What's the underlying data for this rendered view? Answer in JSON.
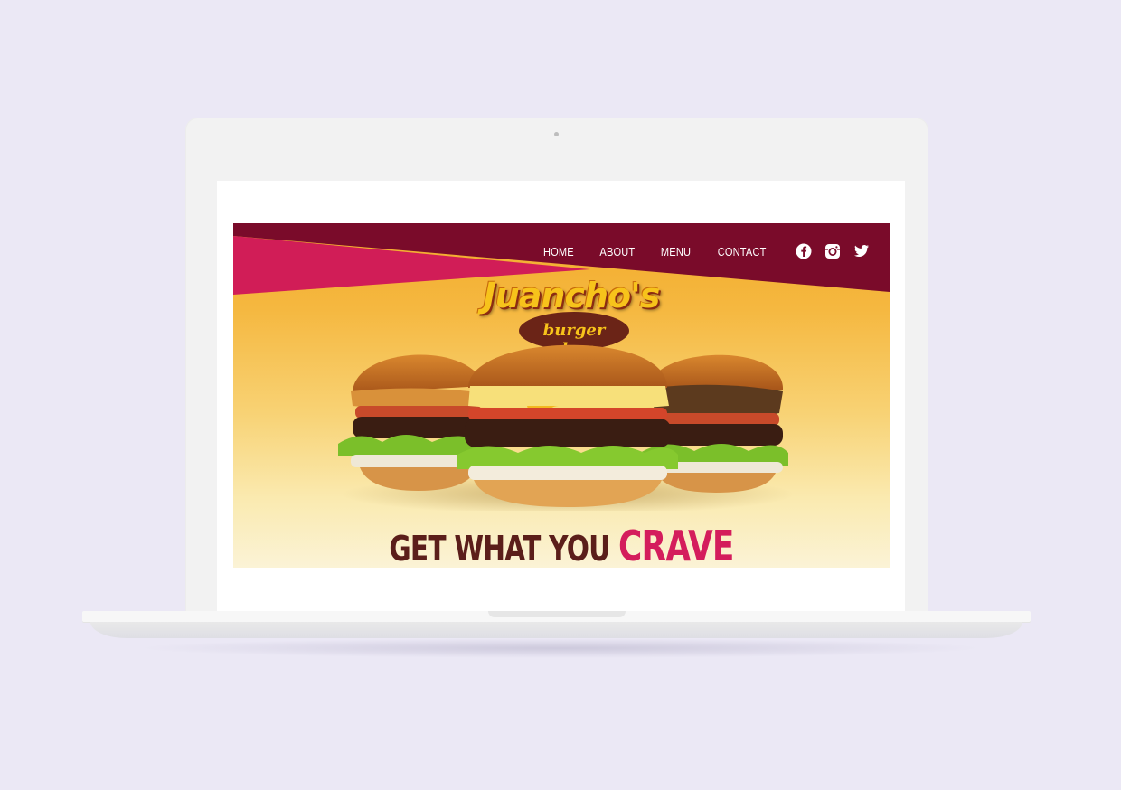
{
  "site": {
    "nav": {
      "items": [
        {
          "label": "HOME"
        },
        {
          "label": "ABOUT"
        },
        {
          "label": "MENU"
        },
        {
          "label": "CONTACT"
        }
      ],
      "social": [
        "facebook-icon",
        "instagram-icon",
        "twitter-icon"
      ]
    },
    "logo": {
      "title": "Juancho's",
      "subtitle": "burger shop"
    },
    "tagline": {
      "lead": "GET WHAT YOU",
      "accent": "CRAVE"
    }
  },
  "colors": {
    "background": "#ebe8f5",
    "band_dark": "#7a0b2a",
    "band_pink": "#d11d57",
    "hero_top": "#f3aa2a",
    "hero_bottom": "#fbf3d6",
    "tagline_dark": "#5b1e1a",
    "tagline_accent": "#d41d5c"
  }
}
